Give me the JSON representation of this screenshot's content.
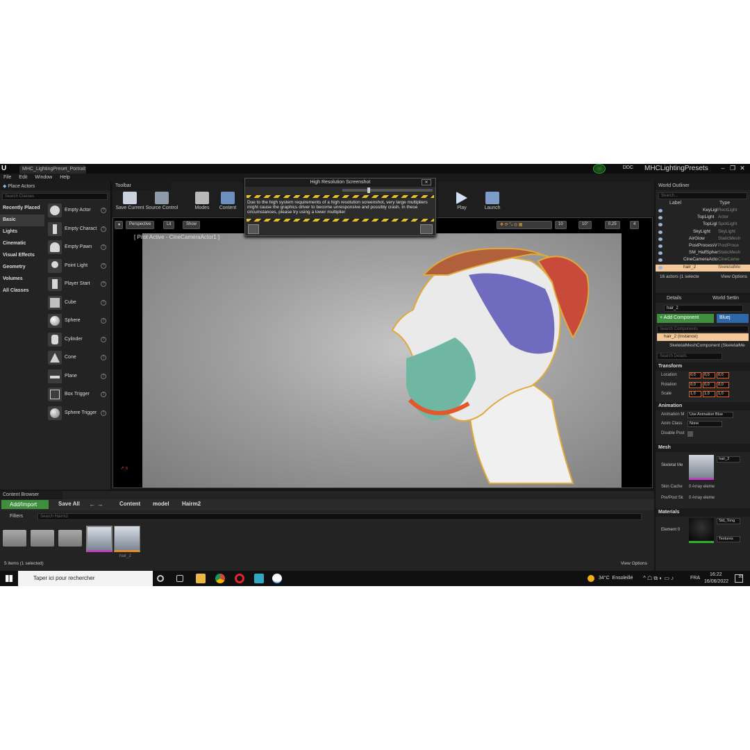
{
  "window": {
    "tab_label": "MHC_LightingPreset_Portrait",
    "project_name": "MHCLightingPresets",
    "ddc_label": "DDC",
    "menu": [
      "File",
      "Edit",
      "Window",
      "Help"
    ]
  },
  "place_actors": {
    "title": "Place Actors",
    "search_placeholder": "Search Classes",
    "categories": [
      "Recently Placed",
      "Basic",
      "Lights",
      "Cinematic",
      "Visual Effects",
      "Geometry",
      "Volumes",
      "All Classes"
    ],
    "selected_category": "Basic",
    "items": [
      "Empty Actor",
      "Empty Charact",
      "Empty Pawn",
      "Point Light",
      "Player Start",
      "Cube",
      "Sphere",
      "Cylinder",
      "Cone",
      "Plane",
      "Box Trigger",
      "Sphere Trigger"
    ]
  },
  "toolbar": {
    "title": "Toolbar",
    "buttons": [
      "Save Current",
      "Source Control",
      "Modes",
      "Content",
      "Play",
      "Launch"
    ]
  },
  "viewport": {
    "perspective": "Perspective",
    "lit": "Lit",
    "show": "Show",
    "pilot_label": "[ Pilot Active - CineCameraActor1 ]",
    "grid_snap": "10",
    "rot_snap": "10°",
    "scale_snap": "0,25",
    "cam_speed": "4"
  },
  "hires_dialog": {
    "title": "High Resolution Screenshot",
    "message": "Due to the high system requirements of a high resolution screenshot, very large multipliers might cause the graphics driver to become unresponsive and possibly crash. In these circumstances, please try using a lower multiplier"
  },
  "outliner": {
    "title": "World Outliner",
    "search_placeholder": "Search...",
    "col_label": "Label",
    "col_type": "Type",
    "rows": [
      {
        "name": "KeyLigl",
        "type": "RectLight"
      },
      {
        "name": "TopLight",
        "type": "Actor"
      },
      {
        "name": "TopLigl",
        "type": "SpotLight"
      },
      {
        "name": "SkyLight",
        "type": "SkyLight"
      },
      {
        "name": "AirGlow",
        "type": "StaticMesh"
      },
      {
        "name": "PostProcessV",
        "type": "PostProce"
      },
      {
        "name": "SM_HalfSpher",
        "type": "StaticMesh"
      },
      {
        "name": "CineCameraActo",
        "type": "CineCame"
      },
      {
        "name": "hair_2",
        "type": "SkeletalMe"
      }
    ],
    "status": "16 actors (1 selecte",
    "view_options": "View Options"
  },
  "details": {
    "tab_details": "Details",
    "tab_world": "World Settin",
    "actor_name": "hair_2",
    "add_component": "+ Add Component",
    "blueprint": "Bluej",
    "search_components": "Search Components",
    "instance": "hair_2 (Instance)",
    "component": "SkeletalMeshComponent (SkeletalMe",
    "search_details": "Search Details",
    "transform": "Transform",
    "location": "Location",
    "rotation": "Rotation",
    "scale": "Scale",
    "loc_vals": [
      "0,0",
      "0,0",
      "0,0"
    ],
    "rot_vals": [
      "0,0",
      "0,0",
      "0,0"
    ],
    "scale_vals": [
      "1,0",
      "1,0",
      "1,0"
    ],
    "animation": "Animation",
    "anim_mode_label": "Animation M",
    "anim_mode_val": "Use Animation Blue",
    "anim_class_label": "Anim Class",
    "anim_class_val": "None",
    "disable_post": "Disable Post",
    "mesh": "Mesh",
    "skel_mesh_label": "Skeletal Me",
    "skel_mesh_val": "hair_2",
    "skin_cache": "Skin Cache",
    "skin_cache_val": "0 Array eleme",
    "prepost": "Pre/Post Sk",
    "prepost_val": "0 Array eleme",
    "materials": "Materials",
    "element0": "Element 0",
    "mat_val": "Std_Tong",
    "textures": "Textures"
  },
  "content_browser": {
    "title": "Content Browser",
    "add_import": "Add/Import",
    "save_all": "Save All",
    "path": [
      "Content",
      "model",
      "Hairm2"
    ],
    "filters": "Filters",
    "search_placeholder": "Search Hairm2",
    "asset_label": "hair_2",
    "status": "5 items (1 selected)",
    "view_options": "View Options"
  },
  "taskbar": {
    "search": "Taper ici pour rechercher",
    "weather": "34°C  Ensoleillé",
    "lang": "FRA",
    "time": "16:22",
    "date": "16/06/2022",
    "notif": "20"
  }
}
